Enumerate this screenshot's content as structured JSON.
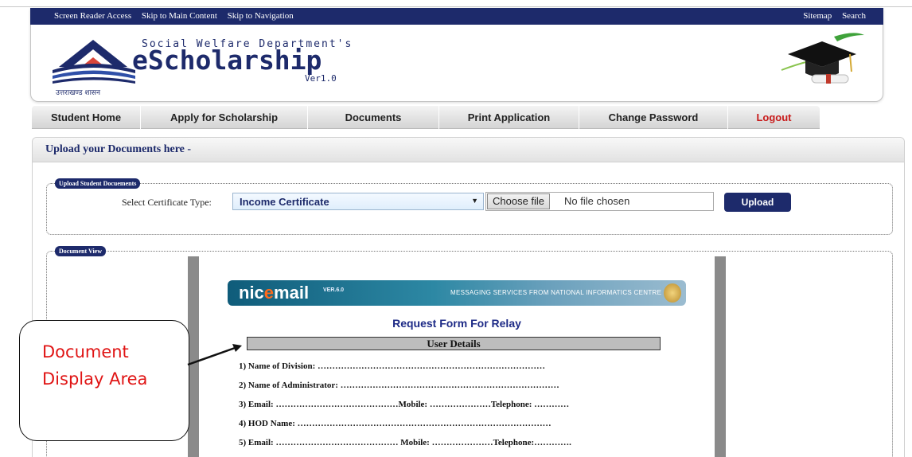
{
  "topbar": {
    "left_links": [
      "Screen Reader Access",
      "Skip to Main Content",
      "Skip to Navigation"
    ],
    "right_links": [
      "Sitemap",
      "Search"
    ]
  },
  "header": {
    "logo_caption": "उत्तराखण्ड शासन",
    "subtitle": "Social Welfare Department's",
    "title": "eScholarship",
    "version": "Ver1.0"
  },
  "nav": {
    "items": [
      "Student Home",
      "Apply for Scholarship",
      "Documents",
      "Print Application",
      "Change Password",
      "Logout"
    ]
  },
  "page": {
    "title": "Upload your Documents here -"
  },
  "upload": {
    "legend": "Upload Student Docuements",
    "label": "Select Certificate Type:",
    "selected_type": "Income Certificate",
    "choose_file": "Choose file",
    "no_file": "No file chosen",
    "upload_button": "Upload"
  },
  "viewer": {
    "legend": "Document View",
    "banner_logo_pre": "nic",
    "banner_logo_e": "e",
    "banner_logo_post": "mail",
    "banner_version": "VER.6.0",
    "banner_tagline": "MESSAGING SERVICES FROM NATIONAL INFORMATICS CENTRE",
    "doc_title": "Request Form For Relay",
    "section": "User Details",
    "lines": [
      "1)  Name of Division: ……………………………………………………………………",
      "2)  Name of Administrator: …………………………………………………………………",
      "3)  Email: ……………………………………Mobile: …………………Telephone: …………",
      "4)  HOD Name: ……………………………………………………………………………",
      "5)  Email: …………………………………… Mobile: …………………Telephone:…………."
    ]
  },
  "callout": {
    "line1": "Document",
    "line2": "Display Area"
  },
  "colors": {
    "brand_navy": "#1d2a6b",
    "logout_red": "#c81a1a",
    "callout_red": "#e01414"
  }
}
